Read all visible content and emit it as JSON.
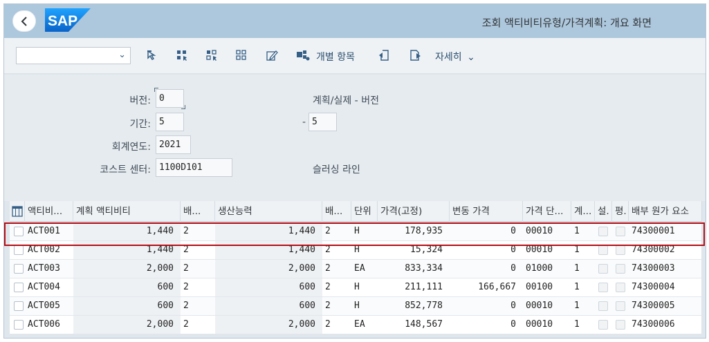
{
  "shell": {
    "title": "조회 액티비티유형/가격계획: 개요 화면",
    "logo_text": "SAP"
  },
  "toolbar": {
    "combo_value": "",
    "individual_items_label": "개별 항목",
    "more_label": "자세히"
  },
  "form": {
    "version_label": "버전:",
    "version_value": "0",
    "version_desc": "계획/실제 - 버전",
    "period_label": "기간:",
    "period_from": "5",
    "period_sep": "-",
    "period_to": "5",
    "fiscal_year_label": "회계연도:",
    "fiscal_year_value": "2021",
    "cost_center_label": "코스트 센터:",
    "cost_center_value": "1100D101",
    "cost_center_desc": "슬러싱 라인"
  },
  "table": {
    "headers": [
      "액티비...",
      "계획 액티비티",
      "배...",
      "생산능력",
      "배...",
      "단위",
      "가격(고정)",
      "변동 가격",
      "가격 단...",
      "계...",
      "설.",
      "평.",
      "배부 원가 요소"
    ],
    "rows": [
      [
        "ACT001",
        "1,440",
        "2",
        "1,440",
        "2",
        "H",
        "178,935",
        "0",
        "00010",
        "1",
        "",
        "",
        "74300001"
      ],
      [
        "ACT002",
        "1,440",
        "2",
        "1,440",
        "2",
        "H",
        "15,324",
        "0",
        "00010",
        "1",
        "",
        "",
        "74300002"
      ],
      [
        "ACT003",
        "2,000",
        "2",
        "2,000",
        "2",
        "EA",
        "833,334",
        "0",
        "01000",
        "1",
        "",
        "",
        "74300003"
      ],
      [
        "ACT004",
        "600",
        "2",
        "600",
        "2",
        "H",
        "211,111",
        "166,667",
        "00100",
        "1",
        "",
        "",
        "74300004"
      ],
      [
        "ACT005",
        "600",
        "2",
        "600",
        "2",
        "H",
        "852,778",
        "0",
        "00010",
        "1",
        "",
        "",
        "74300005"
      ],
      [
        "ACT006",
        "2,000",
        "2",
        "2,000",
        "2",
        "EA",
        "148,567",
        "0",
        "00010",
        "1",
        "",
        "",
        "74300006"
      ]
    ],
    "selected_row": 0
  },
  "colors": {
    "shell": "#adc7dc",
    "highlight": "#b40d14",
    "sap_blue": "#1b7fd1"
  }
}
